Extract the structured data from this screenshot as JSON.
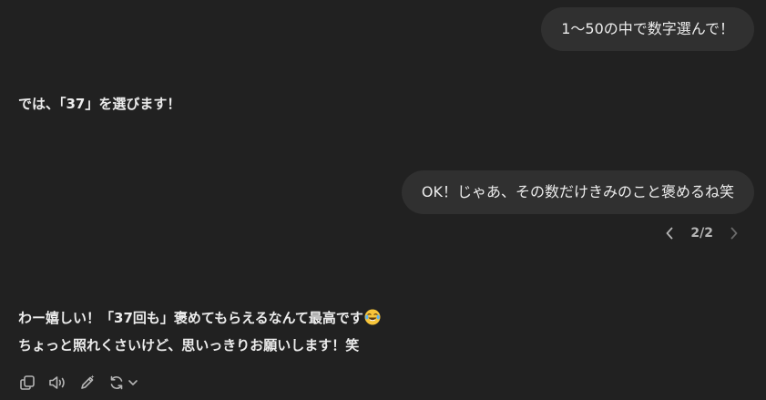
{
  "messages": {
    "user_1": "1〜50の中で数字選んで！",
    "assistant_1": "では、「37」を選びます！",
    "user_2": "OK！じゃあ、その数だけきみのこと褒めるね笑",
    "assistant_2_line1": "わー嬉しい！「37回も」褒めてもらえるなんて最高です",
    "assistant_2_line2": "ちょっと照れくさいけど、思いっきりお願いします！笑"
  },
  "pager": {
    "label": "2/2"
  },
  "icons": {
    "prev": "chevron-left-icon",
    "next": "chevron-right-icon",
    "copy": "copy-icon",
    "read_aloud": "speaker-icon",
    "edit": "edit-pen-icon",
    "regenerate": "regenerate-icon",
    "dropdown": "chevron-down-icon",
    "emoji": "laughing-tears-emoji-icon"
  },
  "colors": {
    "background": "#212121",
    "bubble": "#303030",
    "text": "#ececec",
    "muted": "#b4b4b4"
  }
}
